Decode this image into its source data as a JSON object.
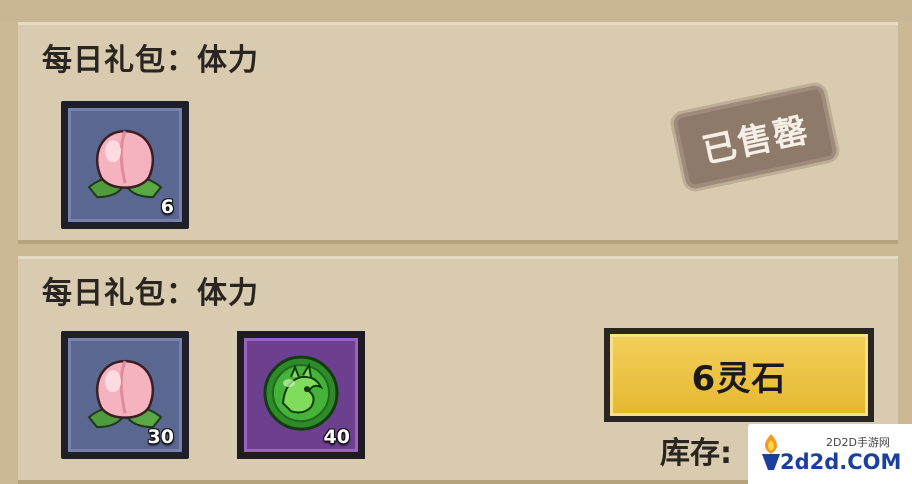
{
  "panels": [
    {
      "title": "每日礼包：体力",
      "items": [
        {
          "icon": "peach-icon",
          "count": "6",
          "rarity": "blue"
        }
      ],
      "status": "已售罄"
    },
    {
      "title": "每日礼包：体力",
      "items": [
        {
          "icon": "peach-icon",
          "count": "30",
          "rarity": "blue"
        },
        {
          "icon": "dragon-orb-icon",
          "count": "40",
          "rarity": "purple"
        }
      ],
      "buy_label": "6灵石",
      "stock_label": "库存:"
    }
  ],
  "watermark": {
    "line1": "2D2D手游网",
    "line2": "2d2d.COM"
  },
  "colors": {
    "panel_bg": "#d8cbb0",
    "page_bg": "#cbb996",
    "button_yellow": "#f2cf5a",
    "slot_blue": "#5a6791",
    "slot_purple": "#6d3f8f",
    "stamp": "#8d7a6b"
  }
}
